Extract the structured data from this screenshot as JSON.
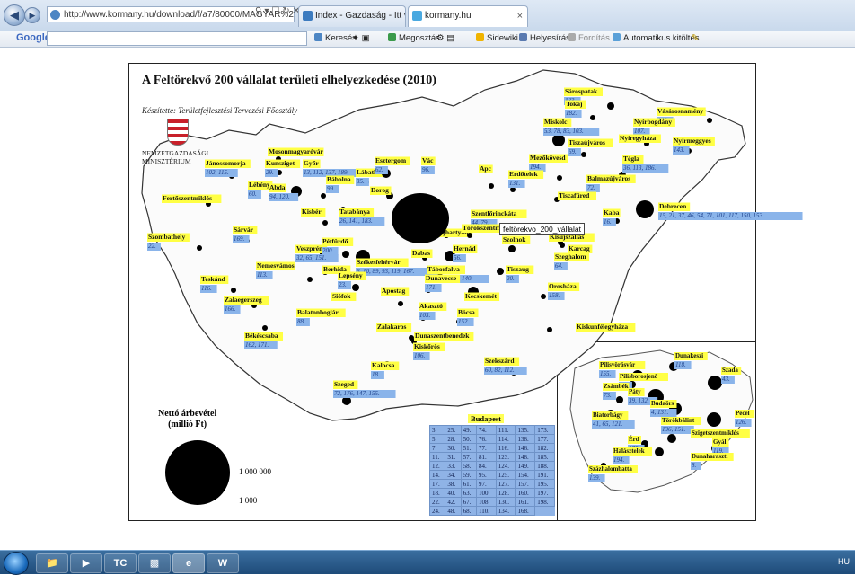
{
  "browser": {
    "address_url": "http://www.kormany.hu/download/f/a7/80000/MAGYAR%20NOVEKE",
    "tabs": [
      {
        "label": "Index - Gazdaság - Itt van Mat..."
      },
      {
        "label": "kormany.hu"
      }
    ]
  },
  "toolbar": {
    "google_label": "Google",
    "search_label": "Keresés",
    "share_label": "Megosztás",
    "sidewiki_label": "Sidewiki",
    "spell_label": "Helyesírás",
    "translate_label": "Fordítás",
    "autofill_label": "Automatikus kitöltés"
  },
  "map": {
    "title": "A Feltörekvő 200 vállalat területi elhelyezkedése (2010)",
    "subtitle": "Készítette: Területfejlesztési Tervezési Főosztály",
    "ministry": "NEMZETGAZDASÁGI MINISZTÉRIUM",
    "tooltip": "feltörekvo_200_vállalat",
    "legend": {
      "title_1": "Nettó árbevétel",
      "title_2": "(millió Ft)",
      "large_value": "1 000 000",
      "small_value": "1 000"
    },
    "budapest_table": {
      "title": "Budapest",
      "rows": [
        [
          "3.",
          "25.",
          "49.",
          "74.",
          "111.",
          "135.",
          "173."
        ],
        [
          "5.",
          "28.",
          "50.",
          "76.",
          "114.",
          "138.",
          "177."
        ],
        [
          "7.",
          "30.",
          "51.",
          "77.",
          "116.",
          "146.",
          "182."
        ],
        [
          "11.",
          "31.",
          "57.",
          "81.",
          "123.",
          "148.",
          "185."
        ],
        [
          "12.",
          "33.",
          "58.",
          "84.",
          "124.",
          "149.",
          "188."
        ],
        [
          "14.",
          "34.",
          "59.",
          "95.",
          "125.",
          "154.",
          "191."
        ],
        [
          "17.",
          "38.",
          "61.",
          "97.",
          "127.",
          "157.",
          "195."
        ],
        [
          "18.",
          "40.",
          "63.",
          "100.",
          "128.",
          "160.",
          "197."
        ],
        [
          "22.",
          "42.",
          "67.",
          "108.",
          "130.",
          "161.",
          "198."
        ],
        [
          "24.",
          "48.",
          "68.",
          "110.",
          "134.",
          "168."
        ]
      ]
    },
    "cities": [
      {
        "name": "Sárospatak",
        "nums": "133."
      },
      {
        "name": "Tokaj",
        "nums": "182."
      },
      {
        "name": "Vásárosnamény",
        "nums": "144."
      },
      {
        "name": "Miskolc",
        "nums": "53, 78, 83, 103."
      },
      {
        "name": "Nyírbogdány",
        "nums": "107."
      },
      {
        "name": "Nyíregyháza",
        "nums": ""
      },
      {
        "name": "Nyírmeggyes",
        "nums": "143."
      },
      {
        "name": "Tiszaújváros",
        "nums": "69."
      },
      {
        "name": "Tégla",
        "nums": "36, 113, 186."
      },
      {
        "name": "Mezőkövesd",
        "nums": "194."
      },
      {
        "name": "Balmazújváros",
        "nums": "72."
      },
      {
        "name": "Apc",
        "nums": ""
      },
      {
        "name": "Erdőtelek",
        "nums": "131."
      },
      {
        "name": "Tiszafüred",
        "nums": ""
      },
      {
        "name": "Kaba",
        "nums": "16."
      },
      {
        "name": "Debrecen",
        "nums": "15, 21, 37, 46, 54, 71, 101, 117, 150, 153."
      },
      {
        "name": "Mosonmagyaróvár",
        "nums": ""
      },
      {
        "name": "Jánossomorja",
        "nums": "102, 115."
      },
      {
        "name": "Kunsziget",
        "nums": "29."
      },
      {
        "name": "Lébény",
        "nums": "60."
      },
      {
        "name": "Győr",
        "nums": "13, 112, 137, 189."
      },
      {
        "name": "Abda",
        "nums": "94, 120."
      },
      {
        "name": "Bábolna",
        "nums": "99."
      },
      {
        "name": "Lábatlan",
        "nums": "35."
      },
      {
        "name": "Esztergom",
        "nums": "62."
      },
      {
        "name": "Vác",
        "nums": "96."
      },
      {
        "name": "Dorog",
        "nums": ""
      },
      {
        "name": "Fertőszentmiklós",
        "nums": ""
      },
      {
        "name": "Kisbér",
        "nums": ""
      },
      {
        "name": "Tatabánya",
        "nums": "26, 141, 183."
      },
      {
        "name": "Szentlőrinckáta",
        "nums": "44, 79."
      },
      {
        "name": "Újhartyán",
        "nums": ""
      },
      {
        "name": "Szolnok",
        "nums": ""
      },
      {
        "name": "Karcag",
        "nums": ""
      },
      {
        "name": "Kisújszállás",
        "nums": ""
      },
      {
        "name": "Szombathely",
        "nums": "22."
      },
      {
        "name": "Sárvár",
        "nums": "169."
      },
      {
        "name": "Veszprém",
        "nums": "32, 65, 151."
      },
      {
        "name": "Pétfürdő",
        "nums": "200."
      },
      {
        "name": "Székesfehérvár",
        "nums": "6, 10, 89, 93, 119, 167."
      },
      {
        "name": "Dabas",
        "nums": ""
      },
      {
        "name": "Hernád",
        "nums": "56."
      },
      {
        "name": "Törökszentmiklós",
        "nums": ""
      },
      {
        "name": "Tiszaug",
        "nums": "20."
      },
      {
        "name": "Szeghalom",
        "nums": "64."
      },
      {
        "name": "Nemesvámos",
        "nums": "113."
      },
      {
        "name": "Berhida",
        "nums": ""
      },
      {
        "name": "Lepsény",
        "nums": "23."
      },
      {
        "name": "Táborfalva",
        "nums": "82, 118, 172, 140."
      },
      {
        "name": "Teskánd",
        "nums": "116."
      },
      {
        "name": "Siófok",
        "nums": ""
      },
      {
        "name": "Apostag",
        "nums": ""
      },
      {
        "name": "Dunavecse",
        "nums": "171."
      },
      {
        "name": "Kecskemét",
        "nums": ""
      },
      {
        "name": "Orosháza",
        "nums": "158."
      },
      {
        "name": "Zalaegerszeg",
        "nums": "166."
      },
      {
        "name": "Balatonboglár",
        "nums": "88."
      },
      {
        "name": "Akasztó",
        "nums": "103."
      },
      {
        "name": "Bócsa",
        "nums": "152."
      },
      {
        "name": "Kiskunfélegyháza",
        "nums": ""
      },
      {
        "name": "Békéscsaba",
        "nums": "162, 171."
      },
      {
        "name": "Zalakaros",
        "nums": ""
      },
      {
        "name": "Dunaszentbenedek",
        "nums": ""
      },
      {
        "name": "Kiskőrös",
        "nums": "106."
      },
      {
        "name": "Kalocsa",
        "nums": "18."
      },
      {
        "name": "Szekszárd",
        "nums": "60, 82, 112."
      },
      {
        "name": "Szeged",
        "nums": "72, 176, 147, 155."
      },
      {
        "name": "Pécs",
        "nums": "86, 87, 93."
      }
    ],
    "inset": [
      {
        "name": "Dunakeszi",
        "nums": "118."
      },
      {
        "name": "Pilisvörösvár",
        "nums": "155."
      },
      {
        "name": "Szada",
        "nums": "43."
      },
      {
        "name": "Pilisborosjenő",
        "nums": "16."
      },
      {
        "name": "Zsámbék",
        "nums": "73."
      },
      {
        "name": "Páty",
        "nums": "39, 132."
      },
      {
        "name": "Budaörs",
        "nums": "4, 131."
      },
      {
        "name": "Biatorbágy",
        "nums": "41, 65, 121."
      },
      {
        "name": "Törökbálint",
        "nums": "136, 151."
      },
      {
        "name": "Pécel",
        "nums": "126."
      },
      {
        "name": "Szigetszentmiklós",
        "nums": ""
      },
      {
        "name": "Érd",
        "nums": "175."
      },
      {
        "name": "Gyál",
        "nums": "119."
      },
      {
        "name": "Halásztelek",
        "nums": "194."
      },
      {
        "name": "Dunaharaszti",
        "nums": "8."
      },
      {
        "name": "Százhalombatta",
        "nums": "139."
      }
    ]
  },
  "taskbar": {
    "language": "HU"
  }
}
